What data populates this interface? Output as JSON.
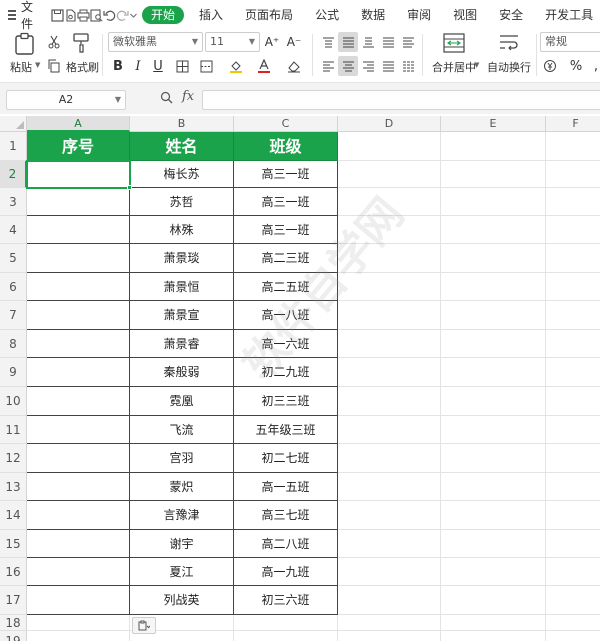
{
  "menubar": {
    "file_label": "文件",
    "tabs": [
      {
        "label": "开始",
        "active": true
      },
      {
        "label": "插入"
      },
      {
        "label": "页面布局"
      },
      {
        "label": "公式"
      },
      {
        "label": "数据"
      },
      {
        "label": "审阅"
      },
      {
        "label": "视图"
      },
      {
        "label": "安全"
      },
      {
        "label": "开发工具"
      }
    ]
  },
  "ribbon": {
    "paste_label": "粘贴",
    "format_painter_label": "格式刷",
    "font_name": "微软雅黑",
    "font_size": "11",
    "merge_label": "合并居中",
    "wrap_label": "自动换行",
    "number_format": "常规",
    "bold": "B",
    "italic": "I",
    "underline": "U",
    "grow_font": "A⁺",
    "shrink_font": "A⁻"
  },
  "formula_bar": {
    "cell_ref": "A2",
    "fx": "fx",
    "value": ""
  },
  "sheet": {
    "columns": [
      "A",
      "B",
      "C",
      "D",
      "E",
      "F"
    ],
    "rows": [
      "1",
      "2",
      "3",
      "4",
      "5",
      "6",
      "7",
      "8",
      "9",
      "10",
      "11",
      "12",
      "13",
      "14",
      "15",
      "16",
      "17",
      "18",
      "19"
    ],
    "headers": [
      "序号",
      "姓名",
      "班级"
    ],
    "data": [
      [
        "",
        "梅长苏",
        "高三一班"
      ],
      [
        "",
        "苏哲",
        "高三一班"
      ],
      [
        "",
        "林殊",
        "高三一班"
      ],
      [
        "",
        "萧景琰",
        "高二三班"
      ],
      [
        "",
        "萧景恒",
        "高二五班"
      ],
      [
        "",
        "萧景宣",
        "高一八班"
      ],
      [
        "",
        "萧景睿",
        "高一六班"
      ],
      [
        "",
        "秦般弱",
        "初二九班"
      ],
      [
        "",
        "霓凰",
        "初三三班"
      ],
      [
        "",
        "飞流",
        "五年级三班"
      ],
      [
        "",
        "宫羽",
        "初二七班"
      ],
      [
        "",
        "蒙炽",
        "高一五班"
      ],
      [
        "",
        "言豫津",
        "高三七班"
      ],
      [
        "",
        "谢宇",
        "高二八班"
      ],
      [
        "",
        "夏江",
        "高一九班"
      ],
      [
        "",
        "列战英",
        "初三六班"
      ]
    ],
    "accent_color": "#1aa34a"
  },
  "watermark": "软件自学网"
}
